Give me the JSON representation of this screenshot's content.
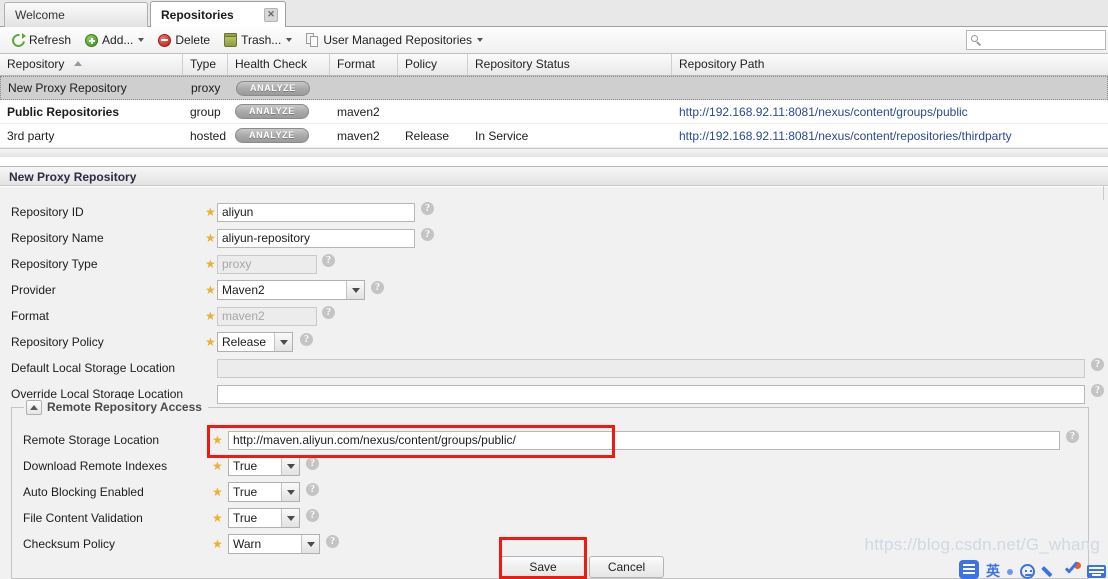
{
  "tabs": [
    {
      "label": "Welcome",
      "active": false,
      "closable": false
    },
    {
      "label": "Repositories",
      "active": true,
      "closable": true,
      "close_glyph": "✕"
    }
  ],
  "toolbar": {
    "refresh_label": "Refresh",
    "add_label": "Add...",
    "delete_label": "Delete",
    "trash_label": "Trash...",
    "user_managed_label": "User Managed Repositories",
    "search_value": "",
    "search_placeholder": ""
  },
  "grid": {
    "columns": [
      {
        "label": "Repository",
        "sorted": "asc"
      },
      {
        "label": "Type"
      },
      {
        "label": "Health Check"
      },
      {
        "label": "Format"
      },
      {
        "label": "Policy"
      },
      {
        "label": "Repository Status"
      },
      {
        "label": "Repository Path"
      }
    ],
    "analyze_label": "ANALYZE",
    "rows": [
      {
        "repository": "New Proxy Repository",
        "type": "proxy",
        "health_check": "ANALYZE",
        "format": "",
        "policy": "",
        "status": "",
        "path": "",
        "selected": true,
        "bold": false
      },
      {
        "repository": "Public Repositories",
        "type": "group",
        "health_check": "ANALYZE",
        "format": "maven2",
        "policy": "",
        "status": "",
        "path": "http://192.168.92.11:8081/nexus/content/groups/public",
        "selected": false,
        "bold": true
      },
      {
        "repository": "3rd party",
        "type": "hosted",
        "health_check": "ANALYZE",
        "format": "maven2",
        "policy": "Release",
        "status": "In Service",
        "path": "http://192.168.92.11:8081/nexus/content/repositories/thirdparty",
        "selected": false,
        "bold": false
      }
    ]
  },
  "panel": {
    "title": "New Proxy Repository",
    "fields": {
      "repository_id": {
        "label": "Repository ID",
        "value": "aliyun",
        "required": true,
        "readonly": false
      },
      "repository_name": {
        "label": "Repository Name",
        "value": "aliyun-repository",
        "required": true,
        "readonly": false
      },
      "repository_type": {
        "label": "Repository Type",
        "value": "proxy",
        "required": true,
        "readonly": true
      },
      "provider": {
        "label": "Provider",
        "value": "Maven2",
        "required": true,
        "type": "select"
      },
      "format": {
        "label": "Format",
        "value": "maven2",
        "required": true,
        "readonly": true
      },
      "repository_policy": {
        "label": "Repository Policy",
        "value": "Release",
        "required": true,
        "type": "select"
      },
      "default_local_storage": {
        "label": "Default Local Storage Location",
        "value": "",
        "required": false,
        "readonly": true
      },
      "override_local_storage": {
        "label": "Override Local Storage Location",
        "value": "",
        "required": false,
        "readonly": false
      }
    },
    "remote_section": {
      "legend": "Remote Repository Access",
      "fields": {
        "remote_storage_location": {
          "label": "Remote Storage Location",
          "value": "http://maven.aliyun.com/nexus/content/groups/public/",
          "required": true,
          "highlighted": true
        },
        "download_remote_indexes": {
          "label": "Download Remote Indexes",
          "value": "True",
          "required": true,
          "type": "select"
        },
        "auto_blocking_enabled": {
          "label": "Auto Blocking Enabled",
          "value": "True",
          "required": true,
          "type": "select"
        },
        "file_content_validation": {
          "label": "File Content Validation",
          "value": "True",
          "required": true,
          "type": "select"
        },
        "checksum_policy": {
          "label": "Checksum Policy",
          "value": "Warn",
          "required": true,
          "type": "select"
        }
      }
    },
    "help_glyph": "?",
    "star_glyph": "★"
  },
  "actions": {
    "save_label": "Save",
    "cancel_label": "Cancel",
    "save_highlighted": true
  },
  "watermark": {
    "text": "https://blog.csdn.net/G_whang"
  },
  "colors": {
    "highlight": "#ee1c10",
    "link": "#2a4a8f",
    "required_star": "#e9b130",
    "accent_blue": "#3a72e8"
  }
}
